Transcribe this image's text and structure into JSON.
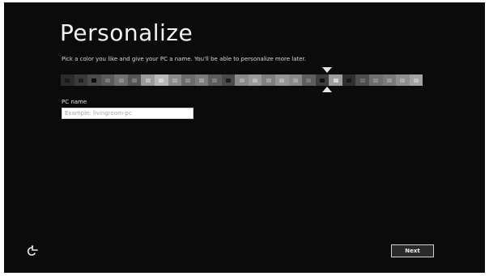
{
  "header": {
    "title": "Personalize",
    "subtitle": "Pick a color you like and give your PC a name. You'll be able to personalize more later."
  },
  "color_picker": {
    "selected_index": 19,
    "swatches": [
      {
        "bg": "#2b2b2b",
        "fg": "#1a1a1a"
      },
      {
        "bg": "#3a3a3a",
        "fg": "#1e1e1e"
      },
      {
        "bg": "#4b4b4b",
        "fg": "#0d0d0d"
      },
      {
        "bg": "#5a5a5a",
        "fg": "#7a7a7a"
      },
      {
        "bg": "#707070",
        "fg": "#8f8f8f"
      },
      {
        "bg": "#555555",
        "fg": "#7a7a7a"
      },
      {
        "bg": "#9a9a9a",
        "fg": "#bdbdbd"
      },
      {
        "bg": "#b8b8b8",
        "fg": "#d6d6d6"
      },
      {
        "bg": "#8c8c8c",
        "fg": "#a9a9a9"
      },
      {
        "bg": "#6c6c6c",
        "fg": "#8d8d8d"
      },
      {
        "bg": "#7b7b7b",
        "fg": "#a0a0a0"
      },
      {
        "bg": "#5c5c5c",
        "fg": "#7e7e7e"
      },
      {
        "bg": "#4a4a4a",
        "fg": "#1c1c1c"
      },
      {
        "bg": "#8a8a8a",
        "fg": "#aaaaaa"
      },
      {
        "bg": "#9a9a9a",
        "fg": "#b9b9b9"
      },
      {
        "bg": "#7e7e7e",
        "fg": "#a1a1a1"
      },
      {
        "bg": "#959595",
        "fg": "#b4b4b4"
      },
      {
        "bg": "#888888",
        "fg": "#a6a6a6"
      },
      {
        "bg": "#5e5e5e",
        "fg": "#7c7c7c"
      },
      {
        "bg": "#3d3d3d",
        "fg": "#111111"
      },
      {
        "bg": "#9d9d9d",
        "fg": "#d4d4d4"
      },
      {
        "bg": "#2f2f2f",
        "fg": "#171717"
      },
      {
        "bg": "#4e4e4e",
        "fg": "#6c6c6c"
      },
      {
        "bg": "#6e6e6e",
        "fg": "#8c8c8c"
      },
      {
        "bg": "#7a7a7a",
        "fg": "#9a9a9a"
      },
      {
        "bg": "#8e8e8e",
        "fg": "#ababab"
      },
      {
        "bg": "#a3a3a3",
        "fg": "#c2c2c2"
      }
    ]
  },
  "pc_name": {
    "label": "PC name",
    "value": "",
    "placeholder": "Example: livingroom-pc"
  },
  "footer": {
    "ease_of_access_icon": "ease-of-access-icon",
    "next_label": "Next"
  },
  "colors": {
    "background": "#0b0b0b",
    "text": "#f2f2f2"
  }
}
